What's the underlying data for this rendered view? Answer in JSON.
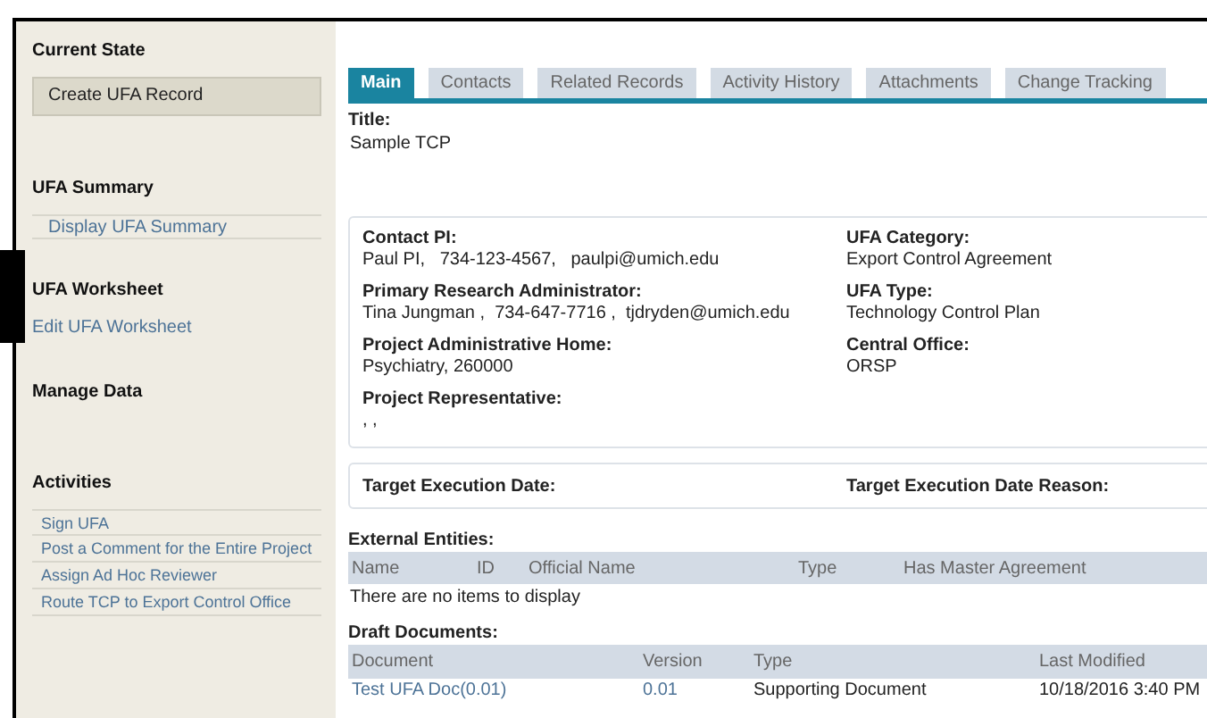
{
  "sidebar": {
    "sections": [
      {
        "title": "Current State",
        "kind": "state",
        "items": [
          {
            "label": "Create UFA Record"
          }
        ]
      },
      {
        "title": "UFA Summary",
        "kind": "boxed",
        "items": [
          {
            "label": "Display UFA Summary"
          }
        ]
      },
      {
        "title": "UFA Worksheet",
        "kind": "plain",
        "items": [
          {
            "label": "Edit UFA Worksheet"
          }
        ]
      },
      {
        "title": "Manage Data",
        "kind": "plain"
      },
      {
        "title": "Activities",
        "kind": "list",
        "items": [
          {
            "label": "Sign UFA"
          },
          {
            "label": "Post a Comment for the Entire Project"
          },
          {
            "label": "Assign Ad Hoc Reviewer"
          },
          {
            "label": "Route TCP to Export Control Office"
          }
        ]
      }
    ]
  },
  "tabs": [
    {
      "label": "Main",
      "selected": true
    },
    {
      "label": "Contacts",
      "selected": false
    },
    {
      "label": "Related Records",
      "selected": false
    },
    {
      "label": "Activity History",
      "selected": false
    },
    {
      "label": "Attachments",
      "selected": false
    },
    {
      "label": "Change Tracking",
      "selected": false
    }
  ],
  "title_field": {
    "label": "Title:",
    "value": "Sample TCP"
  },
  "details": {
    "left": [
      {
        "label": "Contact PI:",
        "value": "Paul PI,   734-123-4567,   paulpi@umich.edu"
      },
      {
        "label": "Primary Research Administrator:",
        "value": "Tina Jungman ,  734-647-7716 ,  tjdryden@umich.edu"
      },
      {
        "label": "Project Administrative Home:",
        "value": "Psychiatry, 260000"
      },
      {
        "label": "Project Representative:",
        "value": ", ,"
      }
    ],
    "right": [
      {
        "label": "UFA Category:",
        "value": "Export Control Agreement"
      },
      {
        "label": "UFA Type:",
        "value": "Technology Control Plan"
      },
      {
        "label": "Central Office:",
        "value": "ORSP"
      }
    ]
  },
  "target": {
    "left": "Target Execution Date:",
    "right": "Target Execution Date Reason:"
  },
  "external_entities": {
    "title": "External Entities:",
    "columns": [
      "Name",
      "ID",
      "Official Name",
      "Type",
      "Has Master Agreement"
    ],
    "empty": "There are no items to display"
  },
  "draft_documents": {
    "title": "Draft Documents:",
    "columns": [
      "Document",
      "Version",
      "Type",
      "Last Modified"
    ],
    "rows": [
      [
        "Test UFA Doc(0.01)",
        "0.01",
        "Supporting Document",
        "10/18/2016 3:40 PM"
      ]
    ]
  }
}
